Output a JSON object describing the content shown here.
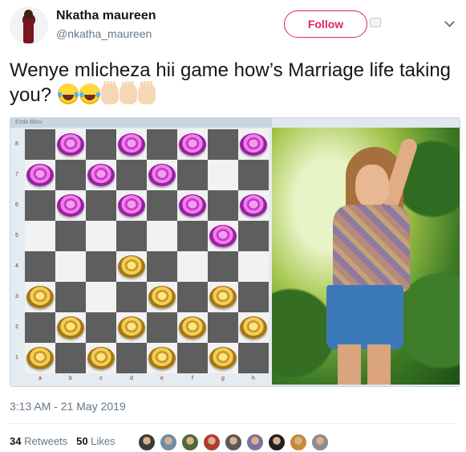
{
  "user": {
    "name": "Nkatha maureen",
    "handle": "@nkatha_maureen"
  },
  "follow_label": "Follow",
  "tweet": {
    "text": "Wenye mlicheza hii game how’s Marriage life taking you?",
    "emojis": [
      "face-with-tears-of-joy",
      "face-with-tears-of-joy",
      "raised-hand",
      "raised-hand",
      "raised-hand"
    ]
  },
  "media": {
    "board_header": "Ezda    Bilou",
    "ranks": [
      "8",
      "7",
      "6",
      "5",
      "4",
      "3",
      "2",
      "1"
    ],
    "files": [
      "a",
      "b",
      "c",
      "d",
      "e",
      "f",
      "g",
      "h"
    ],
    "pink_pieces": [
      "b8",
      "d8",
      "f8",
      "h8",
      "a7",
      "c7",
      "e7",
      "b6",
      "d6",
      "f6",
      "h6",
      "g5"
    ],
    "gold_pieces": [
      "d4",
      "a3",
      "e3",
      "g3",
      "b2",
      "d2",
      "f2",
      "h2",
      "a1",
      "c1",
      "e1",
      "g1"
    ]
  },
  "timestamp": "3:13 AM - 21 May 2019",
  "stats": {
    "retweets_count": "34",
    "retweets_label": "Retweets",
    "likes_count": "50",
    "likes_label": "Likes"
  },
  "likers_count": 9,
  "colors": {
    "follow": "#e0245e",
    "muted": "#657786",
    "board_dark": "#5e5e5e",
    "board_light": "#f2f2f2"
  }
}
